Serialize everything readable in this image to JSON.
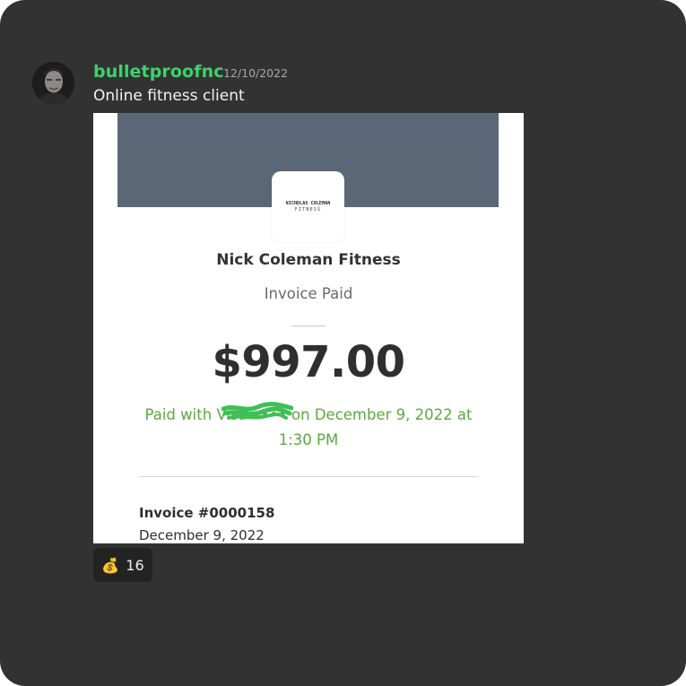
{
  "message": {
    "username": "bulletproofnc",
    "timestamp": "12/10/2022",
    "text": "Online fitness client"
  },
  "attachment": {
    "logo": {
      "line1": "NICHOLAS COLEMAN",
      "line2": "FITNESS"
    },
    "business_name": "Nick Coleman Fitness",
    "status": "Invoice Paid",
    "amount": "$997.00",
    "paid_with": "Paid with Visa •••• on December 9, 2022 at 1:30 PM",
    "invoice_number": "Invoice #0000158",
    "invoice_date": "December 9, 2022"
  },
  "reaction": {
    "icon": "money-bag-icon",
    "emoji": "💰",
    "count": "16"
  },
  "colors": {
    "frame": "#323232",
    "username": "#3bd36b",
    "banner": "#5a6776",
    "paid_text": "#5da83f",
    "redaction": "#3fbf55"
  }
}
